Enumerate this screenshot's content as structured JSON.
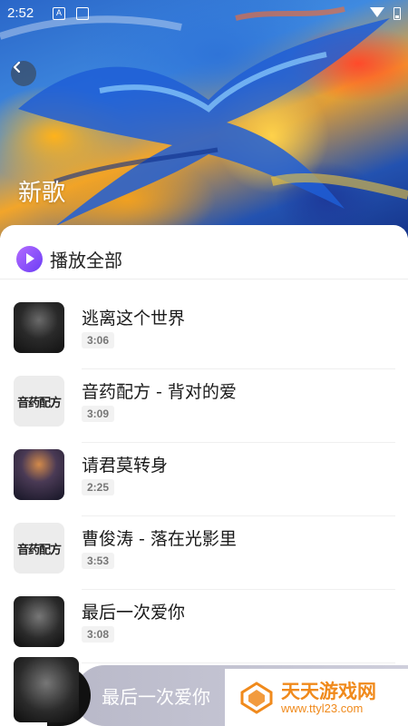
{
  "status_bar": {
    "time": "2:52",
    "notif_icon": "A"
  },
  "header": {
    "title": "新歌"
  },
  "play_all": {
    "label": "播放全部"
  },
  "songs": [
    {
      "title": "逃离这个世界",
      "duration": "3:06",
      "cover": "dark-figure-cover"
    },
    {
      "title": "音药配方 - 背对的爱",
      "duration": "3:09",
      "cover": "音药配方"
    },
    {
      "title": "请君莫转身",
      "duration": "2:25",
      "cover": "girl-in-night-cover"
    },
    {
      "title": "曹俊涛 - 落在光影里",
      "duration": "3:53",
      "cover": "音药配方"
    },
    {
      "title": "最后一次爱你",
      "duration": "3:08",
      "cover": "dark-girl-cover"
    }
  ],
  "mini_player": {
    "title": "最后一次爱你"
  },
  "watermark": {
    "text_cn": "天天游戏网",
    "text_url": "www.ttyl23.com"
  },
  "colors": {
    "accent": "#7b4cf6",
    "watermark": "#f08a1c"
  }
}
